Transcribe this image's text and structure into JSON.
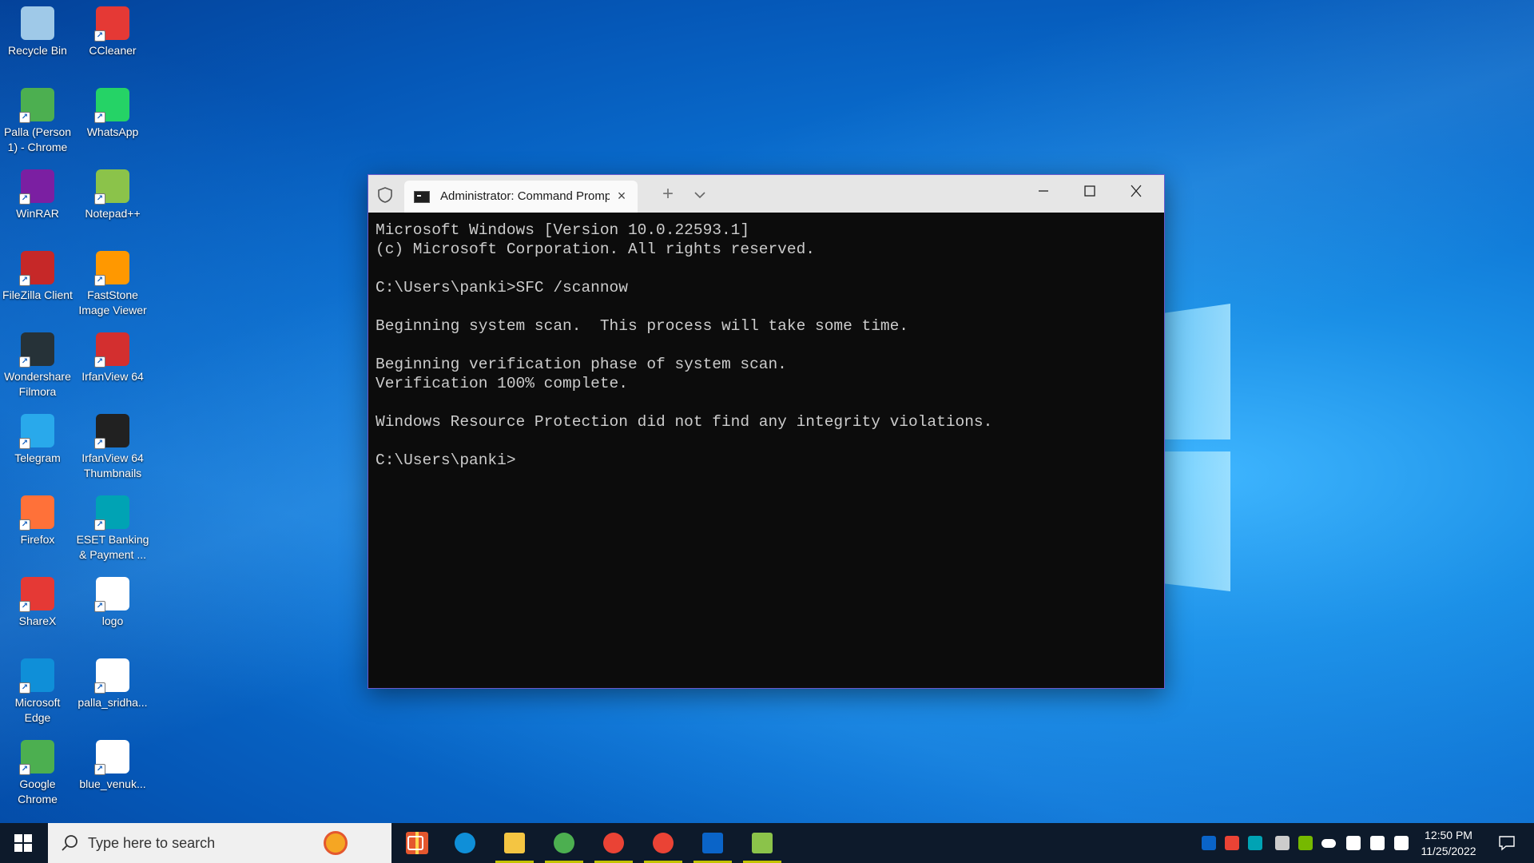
{
  "desktop": {
    "icons": [
      {
        "label": "Recycle Bin",
        "icon": "recycle-bin-icon",
        "color": "#9fc9e8"
      },
      {
        "label": "CCleaner",
        "icon": "ccleaner-icon",
        "color": "#e53935"
      },
      {
        "label": "Palla (Person 1) - Chrome",
        "icon": "chrome-profile-icon",
        "color": "#4caf50"
      },
      {
        "label": "WhatsApp",
        "icon": "whatsapp-icon",
        "color": "#25d366"
      },
      {
        "label": "WinRAR",
        "icon": "winrar-icon",
        "color": "#7b1fa2"
      },
      {
        "label": "Notepad++",
        "icon": "notepad-plus-plus-icon",
        "color": "#8bc34a"
      },
      {
        "label": "FileZilla Client",
        "icon": "filezilla-icon",
        "color": "#c62828"
      },
      {
        "label": "FastStone Image Viewer",
        "icon": "faststone-icon",
        "color": "#ff9800"
      },
      {
        "label": "Wondershare Filmora",
        "icon": "filmora-icon",
        "color": "#263238"
      },
      {
        "label": "IrfanView 64",
        "icon": "irfanview-icon",
        "color": "#d32f2f"
      },
      {
        "label": "Telegram",
        "icon": "telegram-icon",
        "color": "#29a9eb"
      },
      {
        "label": "IrfanView 64 Thumbnails",
        "icon": "irfanview-thumbnails-icon",
        "color": "#212121"
      },
      {
        "label": "Firefox",
        "icon": "firefox-icon",
        "color": "#ff7139"
      },
      {
        "label": "ESET Banking & Payment ...",
        "icon": "eset-banking-icon",
        "color": "#00a3b4"
      },
      {
        "label": "ShareX",
        "icon": "sharex-icon",
        "color": "#e53935"
      },
      {
        "label": "logo",
        "icon": "png-file-icon",
        "color": "#ffffff"
      },
      {
        "label": "Microsoft Edge",
        "icon": "edge-icon",
        "color": "#0f8fd8"
      },
      {
        "label": "palla_sridha...",
        "icon": "png-file-icon",
        "color": "#ffffff"
      },
      {
        "label": "Google Chrome",
        "icon": "chrome-icon",
        "color": "#4caf50"
      },
      {
        "label": "blue_venuk...",
        "icon": "jpg-file-icon",
        "color": "#ffffff"
      }
    ]
  },
  "terminal": {
    "tab_title": "Administrator: Command Prompt",
    "lines": [
      "Microsoft Windows [Version 10.0.22593.1]",
      "(c) Microsoft Corporation. All rights reserved.",
      "",
      "C:\\Users\\panki>SFC /scannow",
      "",
      "Beginning system scan.  This process will take some time.",
      "",
      "Beginning verification phase of system scan.",
      "Verification 100% complete.",
      "",
      "Windows Resource Protection did not find any integrity violations.",
      "",
      "C:\\Users\\panki>"
    ]
  },
  "taskbar": {
    "search_placeholder": "Type here to search",
    "apps": [
      {
        "icon": "task-view-icon",
        "running": false
      },
      {
        "icon": "edge-icon",
        "running": false
      },
      {
        "icon": "file-explorer-icon",
        "running": true
      },
      {
        "icon": "chrome-icon",
        "running": true
      },
      {
        "icon": "chrome-profile-icon",
        "running": true
      },
      {
        "icon": "chrome-profile-icon",
        "running": true
      },
      {
        "icon": "outlook-icon",
        "running": true
      },
      {
        "icon": "notepad-plus-plus-icon",
        "running": true
      }
    ],
    "tray": [
      {
        "icon": "outlook-tray-icon",
        "color": "#0a64c8"
      },
      {
        "icon": "chrome-tray-icon",
        "color": "#ea4335"
      },
      {
        "icon": "eset-tray-icon",
        "color": "#00a3b4"
      },
      {
        "icon": "usb-icon",
        "color": "#cccccc"
      },
      {
        "icon": "nvidia-icon",
        "color": "#76b900"
      },
      {
        "icon": "onedrive-icon",
        "color": "#ffffff"
      },
      {
        "icon": "security-icon",
        "color": "#ffffff"
      },
      {
        "icon": "network-icon",
        "color": "#ffffff"
      },
      {
        "icon": "volume-icon",
        "color": "#ffffff"
      }
    ],
    "time": "12:50 PM",
    "date": "11/25/2022"
  }
}
